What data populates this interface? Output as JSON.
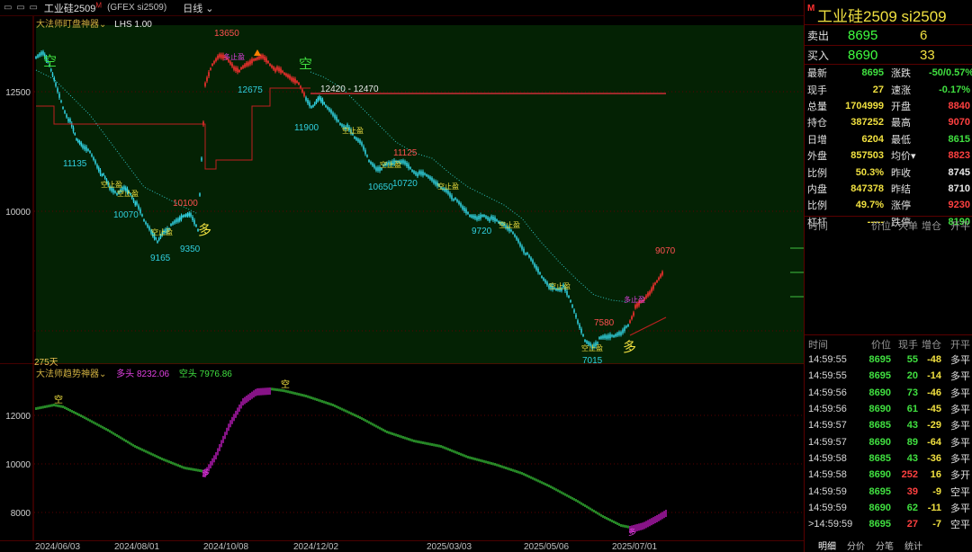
{
  "window": {
    "controls": "▭ ▭ ▭",
    "title": "工业硅2509",
    "title_sup": "M",
    "symbol": "(GFEX si2509)",
    "period": "日线"
  },
  "main_pane": {
    "indicator_name": "大法师盯盘神器",
    "lhs_label": "LHS 1.00",
    "days_label": "275天",
    "y_ticks": [
      "12500",
      "10000"
    ],
    "price_labels": {
      "p13650": "13650",
      "p12675": "12675",
      "p11900": "11900",
      "p11135": "11135",
      "p10070": "10070",
      "p10100": "10100",
      "p9165": "9165",
      "p9350": "9350",
      "p11125": "11125",
      "p10650": "10650",
      "p10720": "10720",
      "p9720": "9720",
      "p7580": "7580",
      "p7015": "7015",
      "p9070": "9070"
    },
    "range_label": "12420 - 12470",
    "signal_kong": "空",
    "signal_duo": "多",
    "signal_kongzhixiang": "空止盈",
    "signal_duozhixiang": "多止盈",
    "colors": {
      "bull_bg": "#042204",
      "up": "#ff3030",
      "down": "#30d0e0",
      "stop": "#e8e040",
      "signal_green": "#40e040"
    }
  },
  "indicator_pane": {
    "name": "大法师趋势神器",
    "bull_label": "多头",
    "bull_value": "8232.06",
    "bear_label": "空头",
    "bear_value": "7976.86",
    "y_ticks": [
      "12000",
      "10000",
      "8000"
    ],
    "marker_kong": "空",
    "marker_duo": "多",
    "colors": {
      "bull": "#e020e0",
      "bear": "#40e040"
    }
  },
  "x_axis": {
    "dates": [
      "2024/06/03",
      "2024/08/01",
      "2024/10/08",
      "2024/12/02",
      "2025/03/03",
      "2025/05/06",
      "2025/07/01"
    ]
  },
  "quote_panel": {
    "badge": "M",
    "title": "工业硅2509  si2509",
    "sell": {
      "label": "卖出",
      "price": "8695",
      "volume": "6"
    },
    "buy": {
      "label": "买入",
      "price": "8690",
      "volume": "33"
    },
    "rows": [
      {
        "l1": "最新",
        "v1": "8695",
        "c1": "c-g",
        "l2": "涨跌",
        "v2": "-50/0.57%",
        "c2": "c-g"
      },
      {
        "l1": "现手",
        "v1": "27",
        "c1": "c-y",
        "l2": "速涨",
        "v2": "-0.17%",
        "c2": "c-g"
      },
      {
        "l1": "总量",
        "v1": "1704999",
        "c1": "c-y",
        "l2": "开盘",
        "v2": "8840",
        "c2": "c-r"
      },
      {
        "l1": "持仓",
        "v1": "387252",
        "c1": "c-y",
        "l2": "最高",
        "v2": "9070",
        "c2": "c-r"
      },
      {
        "l1": "日增",
        "v1": "6204",
        "c1": "c-y",
        "l2": "最低",
        "v2": "8615",
        "c2": "c-g"
      },
      {
        "l1": "外盘",
        "v1": "857503",
        "c1": "c-y",
        "l2": "均价▾",
        "v2": "8823",
        "c2": "c-r"
      },
      {
        "l1": "比例",
        "v1": "50.3%",
        "c1": "c-y",
        "l2": "昨收",
        "v2": "8745",
        "c2": "c-w"
      },
      {
        "l1": "内盘",
        "v1": "847378",
        "c1": "c-y",
        "l2": "昨结",
        "v2": "8710",
        "c2": "c-w"
      },
      {
        "l1": "比例",
        "v1": "49.7%",
        "c1": "c-y",
        "l2": "涨停",
        "v2": "9230",
        "c2": "c-r"
      },
      {
        "l1": "杠杆",
        "v1": "-----",
        "c1": "c-y",
        "l2": "跌停",
        "v2": "8190",
        "c2": "c-g"
      }
    ],
    "big_order_header": [
      "时间",
      "价位",
      "大单",
      "增仓",
      "开平"
    ],
    "ticks_header": [
      "时间",
      "价位",
      "现手",
      "增仓",
      "开平"
    ],
    "ticks": [
      {
        "time": "14:59:55",
        "price": "8695",
        "pc": "c-g",
        "qty": "55",
        "qc": "c-g",
        "oi": "-48",
        "dir": "多平"
      },
      {
        "time": "14:59:55",
        "price": "8695",
        "pc": "c-g",
        "qty": "20",
        "qc": "c-g",
        "oi": "-14",
        "dir": "多平"
      },
      {
        "time": "14:59:56",
        "price": "8690",
        "pc": "c-g",
        "qty": "73",
        "qc": "c-g",
        "oi": "-46",
        "dir": "多平"
      },
      {
        "time": "14:59:56",
        "price": "8690",
        "pc": "c-g",
        "qty": "61",
        "qc": "c-g",
        "oi": "-45",
        "dir": "多平"
      },
      {
        "time": "14:59:57",
        "price": "8685",
        "pc": "c-g",
        "qty": "43",
        "qc": "c-g",
        "oi": "-29",
        "dir": "多平"
      },
      {
        "time": "14:59:57",
        "price": "8690",
        "pc": "c-g",
        "qty": "89",
        "qc": "c-g",
        "oi": "-64",
        "dir": "多平"
      },
      {
        "time": "14:59:58",
        "price": "8685",
        "pc": "c-g",
        "qty": "43",
        "qc": "c-g",
        "oi": "-36",
        "dir": "多平"
      },
      {
        "time": "14:59:58",
        "price": "8690",
        "pc": "c-g",
        "qty": "252",
        "qc": "c-r",
        "oi": "16",
        "dir": "多开"
      },
      {
        "time": "14:59:59",
        "price": "8695",
        "pc": "c-g",
        "qty": "39",
        "qc": "c-r",
        "oi": "-9",
        "dir": "空平"
      },
      {
        "time": "14:59:59",
        "price": "8690",
        "pc": "c-g",
        "qty": "62",
        "qc": "c-g",
        "oi": "-11",
        "dir": "多平"
      },
      {
        "time": ">14:59:59",
        "price": "8695",
        "pc": "c-g",
        "qty": "27",
        "qc": "c-r",
        "oi": "-7",
        "dir": "空平"
      }
    ],
    "tabs": [
      "明细",
      "分价",
      "分笔",
      "统计"
    ]
  }
}
